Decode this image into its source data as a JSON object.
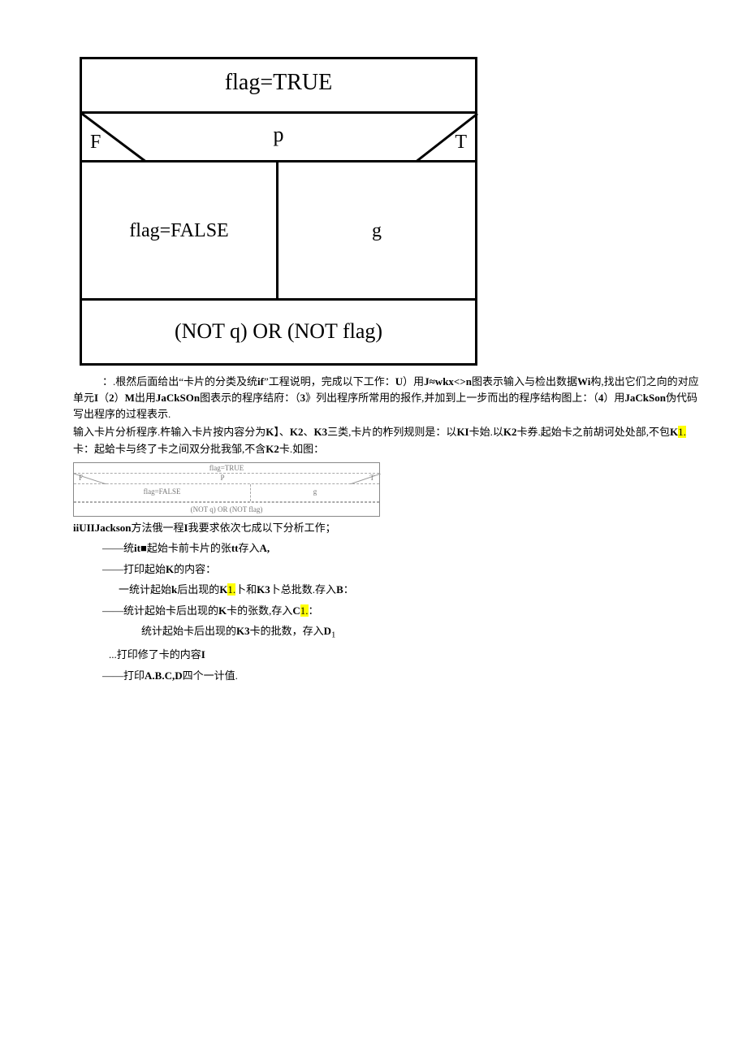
{
  "diagram_large": {
    "row1": "flag=TRUE",
    "row2": {
      "p": "p",
      "F": "F",
      "T": "T"
    },
    "row3": {
      "left": "flag=FALSE",
      "right": "g"
    },
    "row4": "(NOT  q) OR (NOT flag)"
  },
  "para1": {
    "prefix": "：.根然后面给出“卡片的分类及统",
    "b1": "if",
    "mid1": "”工程说明，完成以下工作：",
    "b2": "U",
    "mid2": "）用",
    "b3": "J≈wkx<>n",
    "mid3": "图表示输入与检出数据",
    "b4": "Wi",
    "mid4": "构,找出它们之向的对应单元",
    "b5": "I",
    "mid5": "（",
    "b6": "2",
    "mid6": "）",
    "b7": "M",
    "mid7": "出用",
    "b8": "JaCkSOn",
    "mid8": "图表示的程序结府：（",
    "b9": "3",
    "mid9": "》列出程序所常用的报作,并加到上一步而出的程序结构图上：（",
    "b10": "4",
    "mid10": "）用",
    "b11": "JaCkSon",
    "mid11": "伪代码写出程序的过程表示."
  },
  "para2": {
    "t1": "输入卡片分析程序.杵输入卡片按内容分为",
    "b1": "K",
    "t2": "】、",
    "b2": "K2",
    "t3": "、",
    "b3": "K3",
    "t4": "三类,卡片的柞列规则是：以",
    "b4": "KI",
    "t5": "卡始.以",
    "b5": "K2",
    "t6": "卡券.起始卡之前胡诃处处部,不包",
    "b6": "K",
    "hl1": "1.",
    "t7": "卡：起蛤卡与终了卡之间双分批我邹,不含",
    "b7": "K2",
    "t8": "卡.如图：",
    "u1": "  "
  },
  "diagram_small": {
    "row1": "flag=TRUE",
    "row2": {
      "F": "F",
      "p": "P",
      "T": "T"
    },
    "row3": {
      "left": "flag=FALSE",
      "right": "g"
    },
    "row4": "(NOT  q) OR (NOT flag)"
  },
  "line1": {
    "b1": "iiUIIJackson",
    "t1": "方法俄一程",
    "b2": "I",
    "t2": "我要求依次七成以下分析工作；"
  },
  "items": [
    {
      "lvl": "lvl1",
      "dash": "——",
      "t1": "统",
      "b1": "it■",
      "t2": "起始卡前卡片的张",
      "b2": "tt",
      "t3": "存入",
      "b3": "A,"
    },
    {
      "lvl": "lvl1",
      "dash": "——",
      "t1": "打印起始",
      "b1": "K",
      "t2": "的内容："
    },
    {
      "lvl": "lvl2",
      "dash": "一",
      "t1": "统计起始",
      "b1": "k",
      "t2": "后出现的",
      "b2": "K",
      "hl1": "1.",
      "t3": "卜和",
      "b3": "K3",
      "t4": "卜总批数.存入",
      "b4": "B",
      "t5": "："
    },
    {
      "lvl": "lvl1",
      "dash": "——",
      "t1": "统计起始卡后出现的",
      "b1": "K",
      "hl1": "1.",
      "t2": "卡的张数,存入",
      "b2": "C",
      "t3": "："
    },
    {
      "lvl": "lvl3",
      "dash": "",
      "t1": "统计起始卡后出现的",
      "b1": "K3",
      "t2": "卡的批数，存入",
      "b2": "D",
      "sub": "1"
    },
    {
      "lvl": "lvl1b",
      "dash": "...",
      "t1": "打印修了卡的内容",
      "b1": "I"
    },
    {
      "lvl": "lvl1",
      "dash": "——",
      "t1": "打印",
      "b1": "A.B.C,D",
      "t2": "四个一计值."
    }
  ]
}
